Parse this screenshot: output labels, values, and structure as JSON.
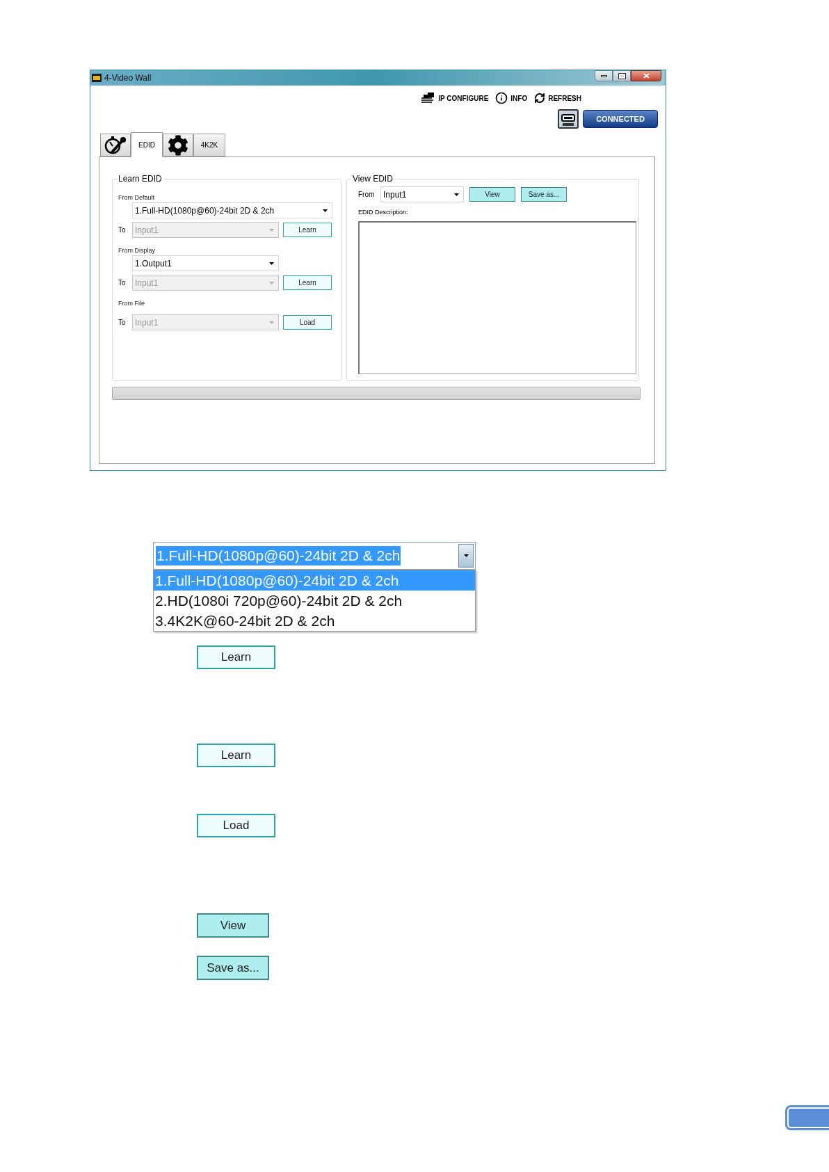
{
  "window": {
    "title": "4-Video Wall"
  },
  "toolbar": [
    {
      "kind": "network",
      "label": "IP CONFIGURE"
    },
    {
      "kind": "info",
      "label": "INFO"
    },
    {
      "kind": "refresh",
      "label": "REFRESH"
    }
  ],
  "connection": {
    "status": "CONNECTED"
  },
  "tabs": [
    {
      "kind": "icon",
      "selected": false
    },
    {
      "kind": "text",
      "label": "EDID",
      "selected": true
    },
    {
      "kind": "gear",
      "selected": false
    },
    {
      "kind": "text",
      "label": "4K2K",
      "selected": false
    }
  ],
  "learn_edid": {
    "title": "Learn EDID",
    "sections": [
      {
        "label": "From Default",
        "source": "1.Full-HD(1080p@60)-24bit 2D & 2ch",
        "to_label": "To",
        "target": "Input1",
        "target_disabled": true,
        "button": "Learn"
      },
      {
        "label": "From Display",
        "source": "1.Output1",
        "to_label": "To",
        "target": "Input1",
        "target_disabled": true,
        "button": "Learn"
      },
      {
        "label": "From File",
        "to_label": "To",
        "target": "Input1",
        "target_disabled": true,
        "button": "Load"
      }
    ]
  },
  "view_edid": {
    "title": "View EDID",
    "from_label": "From",
    "source": "Input1",
    "buttons": [
      "View",
      "Save as..."
    ],
    "description_label": "EDID Description:"
  },
  "progress": {
    "level": 0
  },
  "dropdown_detail": {
    "value": "1.Full-HD(1080p@60)-24bit 2D & 2ch",
    "options": [
      {
        "label": "1.Full-HD(1080p@60)-24bit 2D & 2ch",
        "selected": true
      },
      {
        "label": "2.HD(1080i 720p@60)-24bit 2D & 2ch",
        "selected": false
      },
      {
        "label": "3.4K2K@60-24bit 2D & 2ch",
        "selected": false
      }
    ]
  },
  "button_details": [
    {
      "label": "Learn",
      "kind": "learn"
    },
    {
      "label": "Learn",
      "kind": "learn"
    },
    {
      "label": "Load",
      "kind": "learn"
    },
    {
      "label": "View",
      "kind": "view"
    },
    {
      "label": "Save as...",
      "kind": "view"
    }
  ]
}
